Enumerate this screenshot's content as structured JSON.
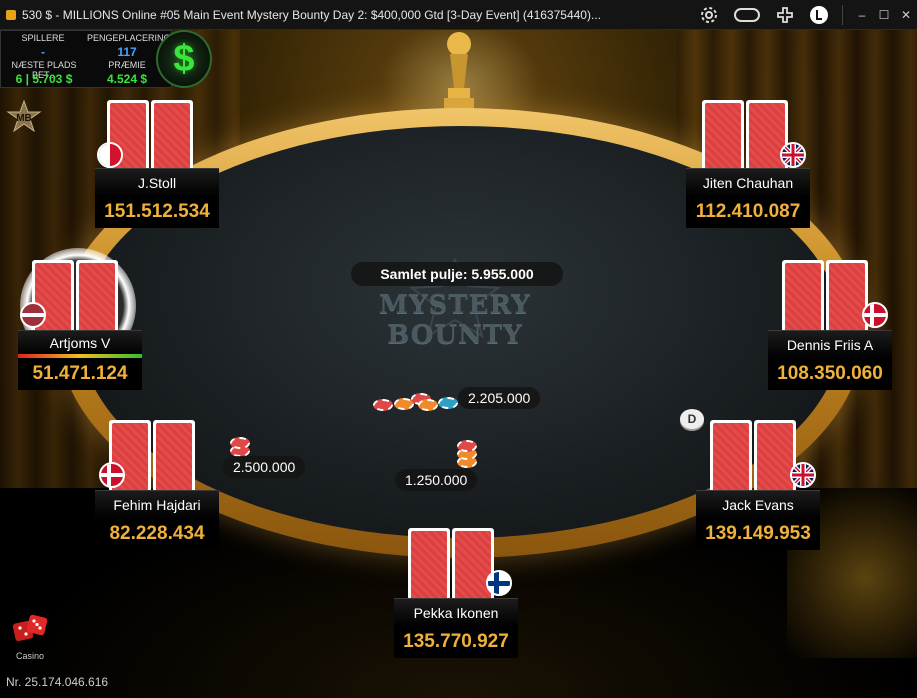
{
  "window": {
    "title": "530 $ - MILLIONS Online #05 Main Event Mystery Bounty Day 2: $400,000 Gtd [3-Day Event] (416375440)...",
    "icons": [
      "gear-icon",
      "chat-toggle-icon",
      "add-table-icon",
      "lobby-icon",
      "minimize-icon",
      "maximize-icon",
      "close-icon"
    ]
  },
  "info_panel": {
    "players_label": "SPILLERE",
    "players_value": "-",
    "position_label": "PENGEPLACERING",
    "position_value": "117",
    "next_label": "NÆSTE PLADS BET...",
    "next_value": "6 | 5.703 $",
    "prize_label": "PRÆMIE",
    "prize_value": "4.524 $",
    "dollar_symbol": "$"
  },
  "badge": {
    "mb": "MB"
  },
  "table": {
    "logo_text": "MYSTERY BOUNTY",
    "pot_text": "Samlet pulje: 5.955.000"
  },
  "seats": [
    {
      "name": "J.Stoll",
      "stack": "151.512.534",
      "flag": "malta"
    },
    {
      "name": "Jiten Chauhan",
      "stack": "112.410.087",
      "flag": "uk"
    },
    {
      "name": "Artjoms V",
      "stack": "51.471.124",
      "flag": "latvia"
    },
    {
      "name": "Dennis Friis A",
      "stack": "108.350.060",
      "flag": "denmark"
    },
    {
      "name": "Fehim Hajdari",
      "stack": "82.228.434",
      "flag": "denmark"
    },
    {
      "name": "Jack Evans",
      "stack": "139.149.953",
      "flag": "uk"
    },
    {
      "name": "Pekka Ikonen",
      "stack": "135.770.927",
      "flag": "finland"
    }
  ],
  "bets": {
    "center": "2.205.000",
    "fehim": "2.500.000",
    "pekka": "1.250.000"
  },
  "dealer_button": "D",
  "casino_label": "Casino",
  "footer": "Nr. 25.174.046.616",
  "colors": {
    "stack": "#f0b13c",
    "rim": "#c88a22",
    "card": "#d9403f"
  }
}
